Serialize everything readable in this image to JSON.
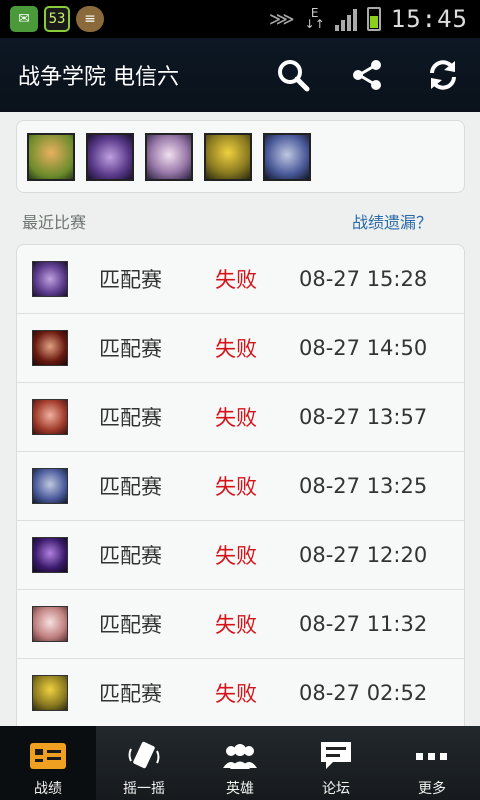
{
  "status_bar": {
    "notif_count": "53",
    "network_label_top": "E",
    "network_label_bottom": "↓↑",
    "time": "15:45"
  },
  "header": {
    "title": "战争学院 电信六",
    "icons": [
      "search-icon",
      "share-icon",
      "refresh-icon"
    ]
  },
  "heroes": [
    "hero-1",
    "hero-2",
    "hero-3",
    "hero-4",
    "hero-5"
  ],
  "recent": {
    "title": "最近比赛",
    "link": "战绩遗漏？"
  },
  "matches": [
    {
      "type": "匹配赛",
      "result": "失败",
      "time": "08-27 15:28"
    },
    {
      "type": "匹配赛",
      "result": "失败",
      "time": "08-27 14:50"
    },
    {
      "type": "匹配赛",
      "result": "失败",
      "time": "08-27 13:57"
    },
    {
      "type": "匹配赛",
      "result": "失败",
      "time": "08-27 13:25"
    },
    {
      "type": "匹配赛",
      "result": "失败",
      "time": "08-27 12:20"
    },
    {
      "type": "匹配赛",
      "result": "失败",
      "time": "08-27 11:32"
    },
    {
      "type": "匹配赛",
      "result": "失败",
      "time": "08-27 02:52"
    }
  ],
  "nav": [
    {
      "label": "战绩",
      "icon": "record-icon",
      "active": true
    },
    {
      "label": "摇一摇",
      "icon": "shake-icon",
      "active": false
    },
    {
      "label": "英雄",
      "icon": "heroes-icon",
      "active": false
    },
    {
      "label": "论坛",
      "icon": "forum-icon",
      "active": false
    },
    {
      "label": "更多",
      "icon": "more-icon",
      "active": false
    }
  ],
  "colors": {
    "loss": "#d4141a",
    "link": "#2a6aa8",
    "header_bg": "#0d1824",
    "active_nav_icon": "#f0a020"
  }
}
